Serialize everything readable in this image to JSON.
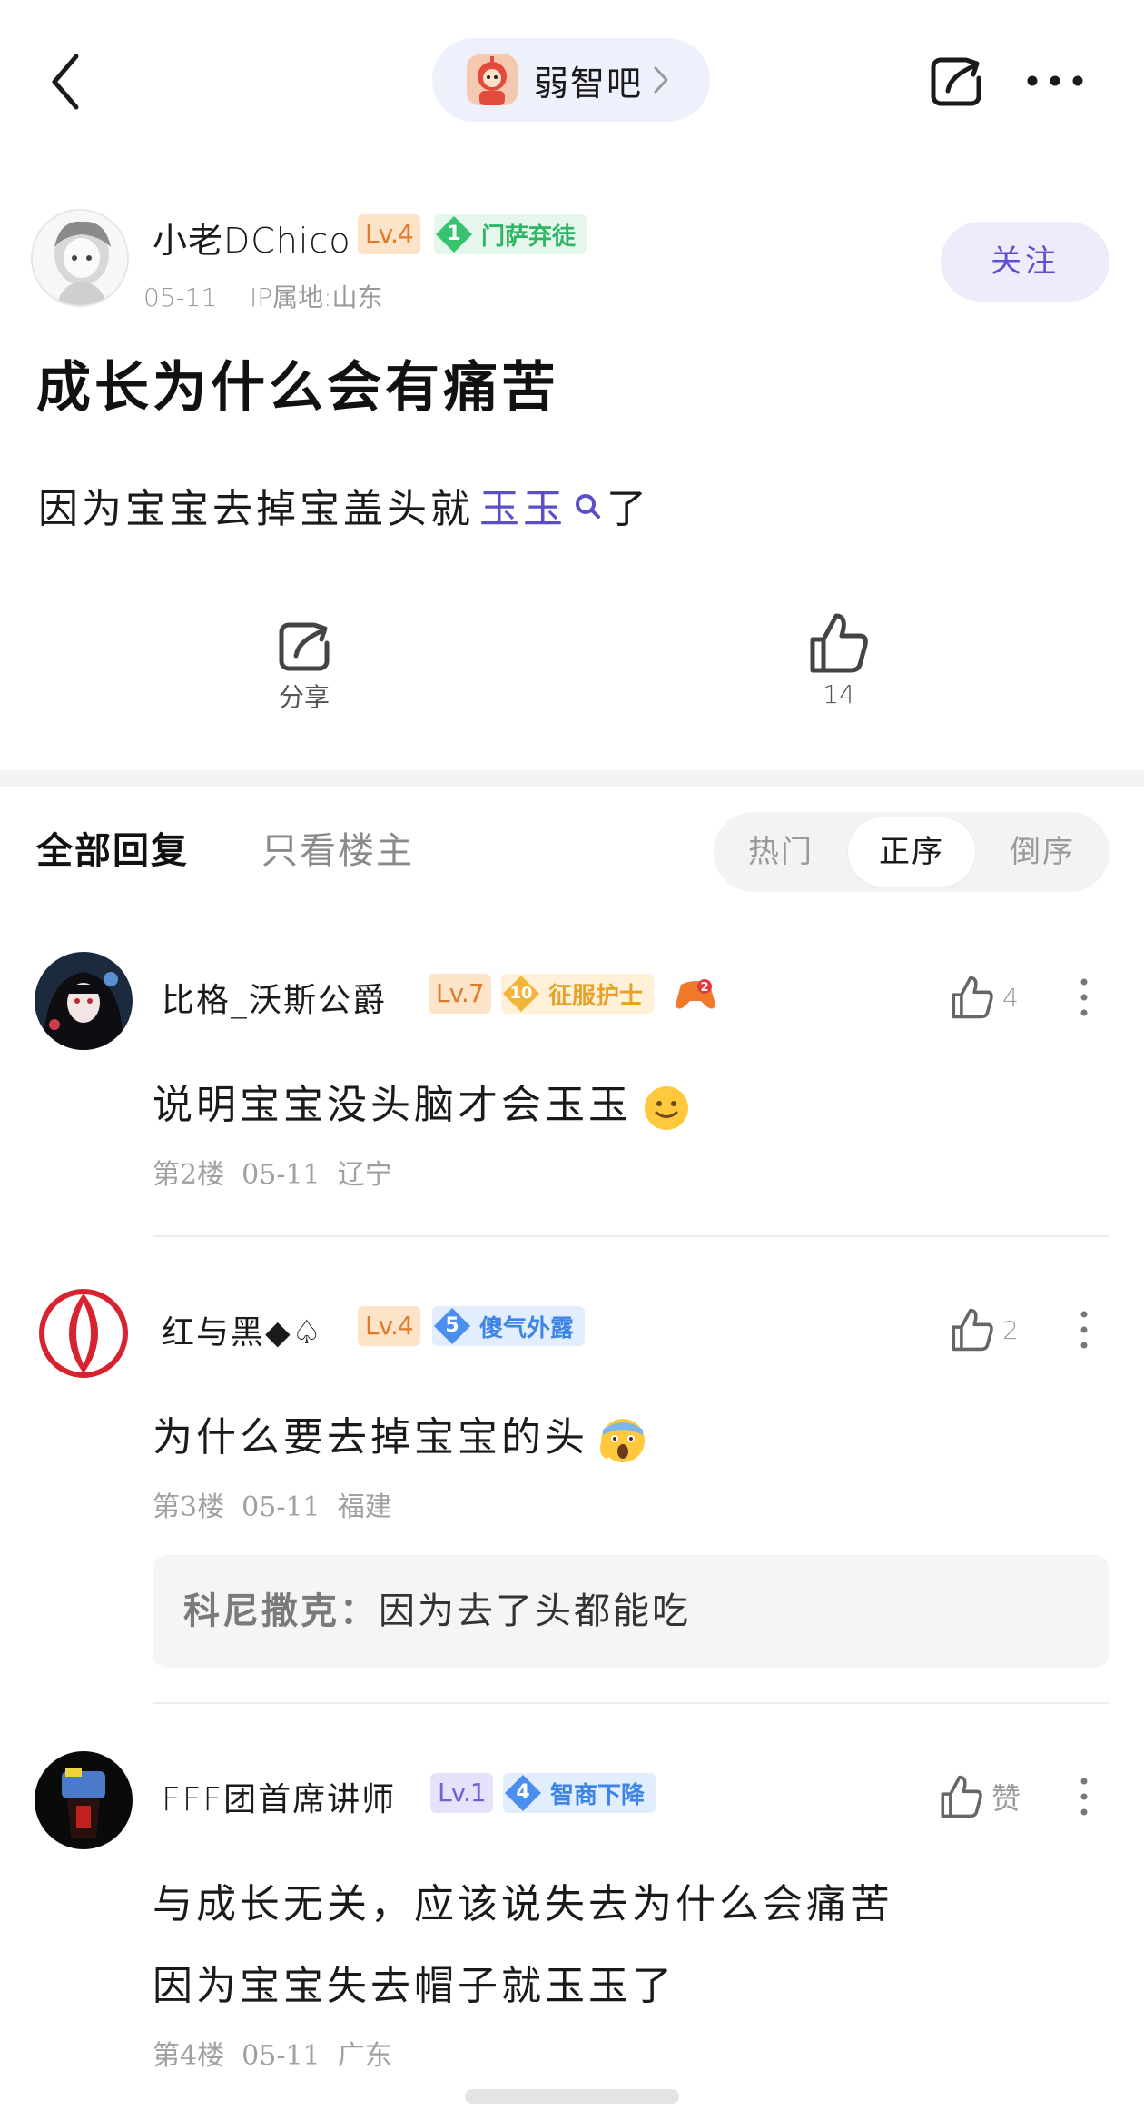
{
  "header": {
    "forum_name": "弱智吧"
  },
  "post": {
    "author": {
      "name": "小老DChico",
      "level": "Lv.4",
      "title_rank": "1",
      "title_name": "门萨弃徒",
      "meta": "05-11    IP属地:山东"
    },
    "follow_label": "关注",
    "title": "成长为什么会有痛苦",
    "body_prefix": "因为宝宝去掉宝盖头就",
    "body_link": "玉玉",
    "body_suffix": "了",
    "share_label": "分享",
    "like_count": "14"
  },
  "tabs": {
    "all_replies": "全部回复",
    "op_only": "只看楼主",
    "sort_options": [
      "热门",
      "正序",
      "倒序"
    ],
    "sort_selected": "正序"
  },
  "replies": [
    {
      "name": "比格_沃斯公爵",
      "level": "Lv.7",
      "title_rank": "10",
      "title_name": "征服护士",
      "likes": "4",
      "text": "说明宝宝没头脑才会玉玉",
      "meta": "第2楼  05-11  辽宁"
    },
    {
      "name": "红与黑◆♤",
      "level": "Lv.4",
      "title_rank": "5",
      "title_name": "傻气外露",
      "likes": "2",
      "text": "为什么要去掉宝宝的头",
      "meta": "第3楼  05-11  福建",
      "sub_reply": {
        "author": "科尼撒克：",
        "text": "因为去了头都能吃"
      }
    },
    {
      "name": "FFF团首席讲师",
      "level": "Lv.1",
      "title_rank": "4",
      "title_name": "智商下降",
      "likes": "赞",
      "text_line1": "与成长无关，应该说失去为什么会痛苦",
      "text_line2": "因为宝宝失去帽子就玉玉了",
      "meta": "第4楼  05-11  广东"
    }
  ],
  "colors": {
    "accent": "#5c4fd0",
    "follow_bg": "#eeecfb",
    "level_orange_bg": "#fde3c8",
    "level_orange_fg": "#e07a2b",
    "level_purple_bg": "#e6e2fb",
    "title_green": "#2fb565",
    "title_gold": "#e5a12a",
    "title_blue": "#3c85e6"
  },
  "icons": [
    "back-arrow-icon",
    "chevron-right-icon",
    "share-icon",
    "more-icon",
    "search-icon",
    "thumbs-up-icon",
    "gem-icon",
    "game-controller-icon",
    "smile-emoji-icon",
    "scream-emoji-icon"
  ]
}
